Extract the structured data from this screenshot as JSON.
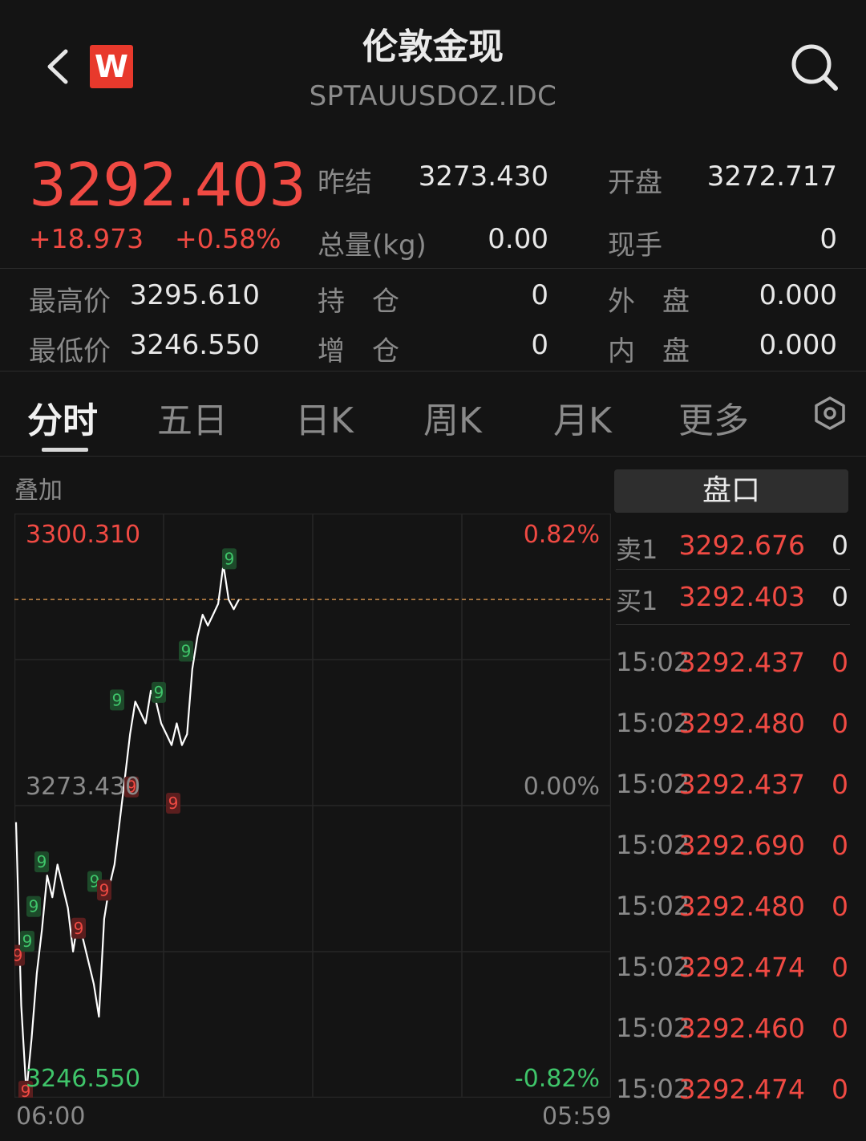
{
  "header": {
    "title": "伦敦金现",
    "subtitle": "SPTAUUSDOZ.IDC",
    "logo_text": "W"
  },
  "quote": {
    "price": "3292.403",
    "change": "+18.973",
    "change_pct": "+0.58%",
    "stats": [
      {
        "label": "昨结",
        "value": "3273.430"
      },
      {
        "label": "开盘",
        "value": "3272.717"
      },
      {
        "label": "总量(kg)",
        "value": "0.00"
      },
      {
        "label": "现手",
        "value": "0"
      },
      {
        "label": "最高价",
        "value": "3295.610"
      },
      {
        "label": "持　仓",
        "value": "0"
      },
      {
        "label": "外　盘",
        "value": "0.000"
      },
      {
        "label": "最低价",
        "value": "3246.550"
      },
      {
        "label": "增　仓",
        "value": "0"
      },
      {
        "label": "内　盘",
        "value": "0.000"
      }
    ]
  },
  "tabs": [
    "分时",
    "五日",
    "日K",
    "周K",
    "月K",
    "更多"
  ],
  "chart": {
    "overlay_label": "叠加",
    "y_top": "3300.310",
    "y_mid": "3273.430",
    "y_bottom": "3246.550",
    "pct_top": "0.82%",
    "pct_mid": "0.00%",
    "pct_bottom": "-0.82%",
    "time_start": "06:00",
    "time_end": "05:59",
    "marker_text": "9"
  },
  "chart_data": {
    "type": "line",
    "xlabel": "",
    "ylabel": "",
    "ylim": [
      3246.55,
      3300.31
    ],
    "x_range": [
      "06:00",
      "05:59"
    ],
    "reference_line": 3292.403,
    "series": [
      {
        "values": [
          3271.9,
          3255,
          3247,
          3252,
          3258,
          3262,
          3267,
          3265,
          3268,
          3266,
          3264,
          3260,
          3263,
          3261,
          3259,
          3257,
          3254,
          3263,
          3266,
          3268,
          3272,
          3276,
          3280,
          3283,
          3282,
          3281,
          3284,
          3283,
          3281,
          3280,
          3279,
          3281,
          3279,
          3280,
          3286,
          3289,
          3291,
          3290,
          3291,
          3292,
          3295.61,
          3292.4,
          3291.5,
          3292.403
        ]
      }
    ],
    "markers": [
      {
        "color": "red",
        "value": 3259.5
      },
      {
        "color": "green",
        "value": 3260.8
      },
      {
        "color": "green",
        "value": 3264.0
      },
      {
        "color": "green",
        "value": 3268.1
      },
      {
        "color": "red",
        "value": 3262.0
      },
      {
        "color": "green",
        "value": 3266.3
      },
      {
        "color": "red",
        "value": 3265.5
      },
      {
        "color": "green",
        "value": 3283.0
      },
      {
        "color": "red",
        "value": 3275.0
      },
      {
        "color": "green",
        "value": 3283.7
      },
      {
        "color": "red",
        "value": 3273.5
      },
      {
        "color": "green",
        "value": 3287.5
      },
      {
        "color": "green",
        "value": 3296.0
      },
      {
        "color": "red",
        "value": 3247.0
      }
    ]
  },
  "orderbook": {
    "title": "盘口",
    "levels": [
      {
        "label": "卖1",
        "price": "3292.676",
        "vol": "0"
      },
      {
        "label": "买1",
        "price": "3292.403",
        "vol": "0"
      }
    ],
    "ticks": [
      {
        "time": "15:02",
        "price": "3292.437",
        "vol": "0"
      },
      {
        "time": "15:02",
        "price": "3292.480",
        "vol": "0"
      },
      {
        "time": "15:02",
        "price": "3292.437",
        "vol": "0"
      },
      {
        "time": "15:02",
        "price": "3292.690",
        "vol": "0"
      },
      {
        "time": "15:02",
        "price": "3292.480",
        "vol": "0"
      },
      {
        "time": "15:02",
        "price": "3292.474",
        "vol": "0"
      },
      {
        "time": "15:02",
        "price": "3292.460",
        "vol": "0"
      },
      {
        "time": "15:02",
        "price": "3292.474",
        "vol": "0"
      }
    ]
  },
  "colors": {
    "up": "#f04a43",
    "down": "#3fc56a",
    "line": "#ffffff",
    "background": "#141414"
  },
  "icons": [
    "back-icon",
    "search-icon",
    "settings-icon"
  ]
}
